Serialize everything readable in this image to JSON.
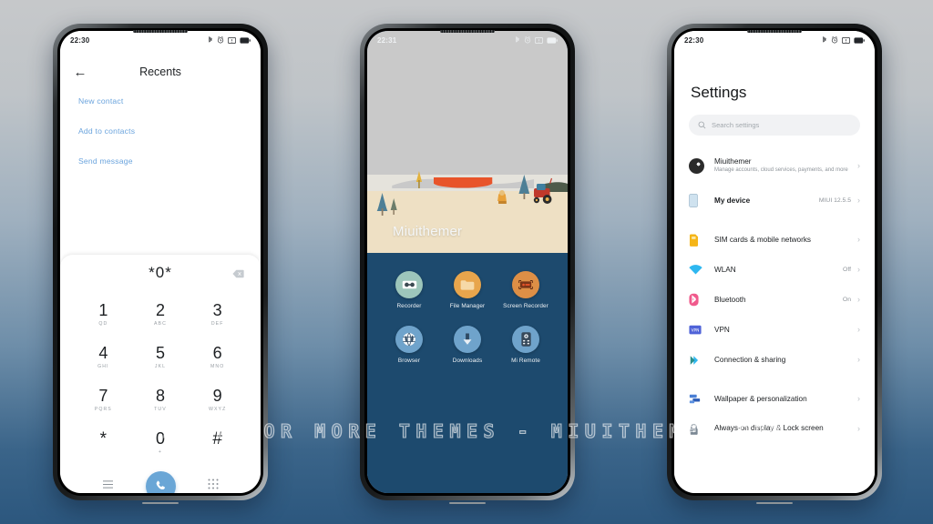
{
  "watermark": {
    "text": "VISIT FOR MORE THEMES - MIUITHEMER.COM"
  },
  "phones": {
    "left": {
      "status": {
        "time": "22:30",
        "icons": [
          "bluetooth-icon",
          "alarm-icon",
          "sim-alert-icon",
          "battery-icon"
        ]
      },
      "dialer": {
        "back_label": "←",
        "title": "Recents",
        "links": [
          "New contact",
          "Add to contacts",
          "Send message"
        ],
        "number": "*0*",
        "delete_icon": "backspace-icon",
        "keys": [
          {
            "digit": "1",
            "letters": "QD"
          },
          {
            "digit": "2",
            "letters": "ABC"
          },
          {
            "digit": "3",
            "letters": "DEF"
          },
          {
            "digit": "4",
            "letters": "GHI"
          },
          {
            "digit": "5",
            "letters": "JKL"
          },
          {
            "digit": "6",
            "letters": "MNO"
          },
          {
            "digit": "7",
            "letters": "PQRS"
          },
          {
            "digit": "8",
            "letters": "TUV"
          },
          {
            "digit": "9",
            "letters": "WXYZ"
          },
          {
            "digit": "*",
            "letters": ""
          },
          {
            "digit": "0",
            "letters": "+"
          },
          {
            "digit": "#",
            "letters": ""
          }
        ],
        "bottom": [
          "menu-icon",
          "call-icon",
          "keypad-icon"
        ],
        "call_button_color": "#6aa6d6"
      }
    },
    "center": {
      "status": {
        "time": "22:31",
        "icons": [
          "bluetooth-icon",
          "alarm-icon",
          "sim-alert-icon",
          "battery-icon"
        ]
      },
      "home": {
        "wallpaper_label": "Miuithemer",
        "apps": [
          {
            "name": "Recorder",
            "icon": "recorder-icon",
            "color": "#9dc6bb"
          },
          {
            "name": "File Manager",
            "icon": "folder-icon",
            "color": "#e8a54c"
          },
          {
            "name": "Screen Recorder",
            "icon": "screen-recorder-icon",
            "color": "#dd8f46"
          },
          {
            "name": "Browser",
            "icon": "globe-icon",
            "color": "#6fa3cb"
          },
          {
            "name": "Downloads",
            "icon": "download-arrow-icon",
            "color": "#6fa3cb"
          },
          {
            "name": "Mi Remote",
            "icon": "remote-icon",
            "color": "#6fa3cb"
          }
        ]
      }
    },
    "right": {
      "status": {
        "time": "22:30",
        "icons": [
          "bluetooth-icon",
          "alarm-icon",
          "sim-alert-icon",
          "battery-icon"
        ]
      },
      "settings": {
        "title": "Settings",
        "search_placeholder": "Search settings",
        "search_icon": "search-icon",
        "rows": [
          {
            "label": "Miuithemer",
            "sub": "Manage accounts, cloud services, payments, and more",
            "value": "",
            "icon": "account-avatar",
            "bold": false
          },
          {
            "label": "My device",
            "sub": "",
            "value": "MIUI 12.5.5",
            "icon": "device-icon",
            "bold": true
          },
          {
            "label": "SIM cards & mobile networks",
            "sub": "",
            "value": "",
            "icon": "sim-card-icon",
            "bold": false
          },
          {
            "label": "WLAN",
            "sub": "",
            "value": "Off",
            "icon": "wifi-icon",
            "bold": false
          },
          {
            "label": "Bluetooth",
            "sub": "",
            "value": "On",
            "icon": "bluetooth-settings-icon",
            "bold": false
          },
          {
            "label": "VPN",
            "sub": "",
            "value": "",
            "icon": "vpn-icon",
            "bold": false
          },
          {
            "label": "Connection & sharing",
            "sub": "",
            "value": "",
            "icon": "connection-sharing-icon",
            "bold": false
          },
          {
            "label": "Wallpaper & personalization",
            "sub": "",
            "value": "",
            "icon": "wallpaper-icon",
            "bold": false
          },
          {
            "label": "Always-on display & Lock screen",
            "sub": "",
            "value": "",
            "icon": "lock-icon",
            "bold": false
          }
        ],
        "chevron": "›"
      }
    }
  }
}
